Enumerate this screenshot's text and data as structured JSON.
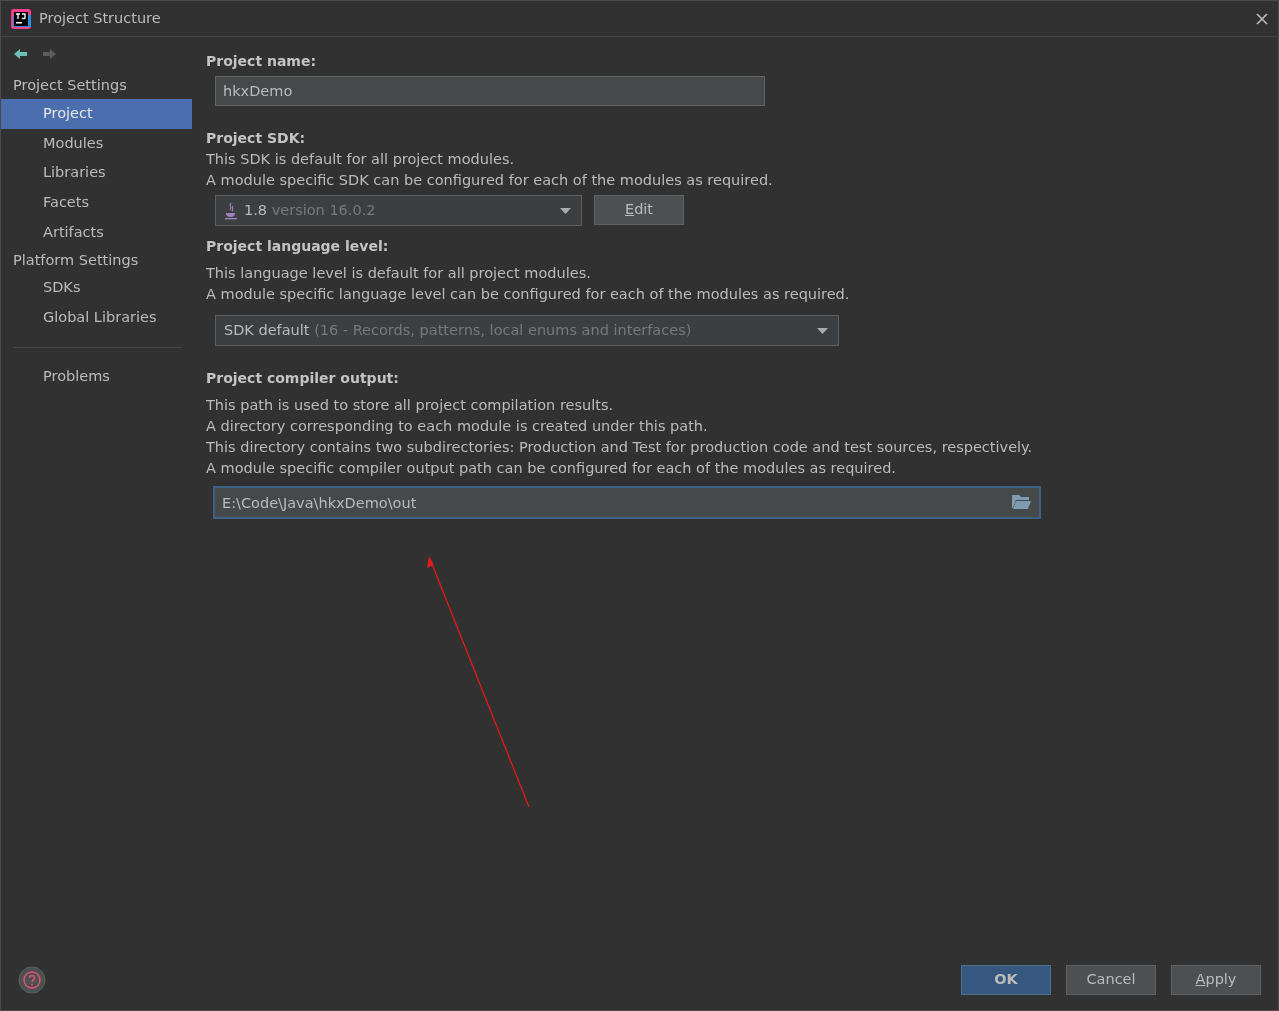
{
  "window": {
    "title": "Project Structure"
  },
  "nav": [
    {
      "kind": "back",
      "disabled": false
    },
    {
      "kind": "forward",
      "disabled": true
    }
  ],
  "sidebar": {
    "sections": [
      {
        "label": "Project Settings",
        "items": [
          {
            "label": "Project",
            "selected": true
          },
          {
            "label": "Modules",
            "selected": false
          },
          {
            "label": "Libraries",
            "selected": false
          },
          {
            "label": "Facets",
            "selected": false
          },
          {
            "label": "Artifacts",
            "selected": false
          }
        ]
      },
      {
        "label": "Platform Settings",
        "items": [
          {
            "label": "SDKs",
            "selected": false
          },
          {
            "label": "Global Libraries",
            "selected": false
          }
        ]
      }
    ],
    "extra_items": [
      {
        "label": "Problems",
        "selected": false
      }
    ]
  },
  "project_name": {
    "label": "Project name:",
    "value": "hkxDemo"
  },
  "project_sdk": {
    "label": "Project SDK:",
    "description": [
      "This SDK is default for all project modules.",
      "A module specific SDK can be configured for each of the modules as required."
    ],
    "value": "1.8",
    "detail": "version 16.0.2",
    "edit_button": {
      "label": "Edit",
      "mnemonic_underlined": true
    }
  },
  "language_level": {
    "label": "Project language level:",
    "description": [
      "This language level is default for all project modules.",
      "A module specific language level can be configured for each of the modules as required."
    ],
    "value": "SDK default",
    "detail": "(16 - Records, patterns, local enums and interfaces)"
  },
  "compiler_output": {
    "label": "Project compiler output:",
    "description": [
      "This path is used to store all project compilation results.",
      "A directory corresponding to each module is created under this path.",
      "This directory contains two subdirectories: Production and Test for production code and test sources, respectively.",
      "A module specific compiler output path can be configured for each of the modules as required."
    ],
    "value": "E:\\Code\\Java\\hkxDemo\\out",
    "focused": true
  },
  "buttons": [
    {
      "label": "OK",
      "kind": "primary",
      "mnemonic_underlined": false
    },
    {
      "label": "Cancel",
      "kind": "secondary",
      "mnemonic_underlined": false
    },
    {
      "label": "Apply",
      "kind": "secondary",
      "mnemonic_underlined": true
    }
  ]
}
